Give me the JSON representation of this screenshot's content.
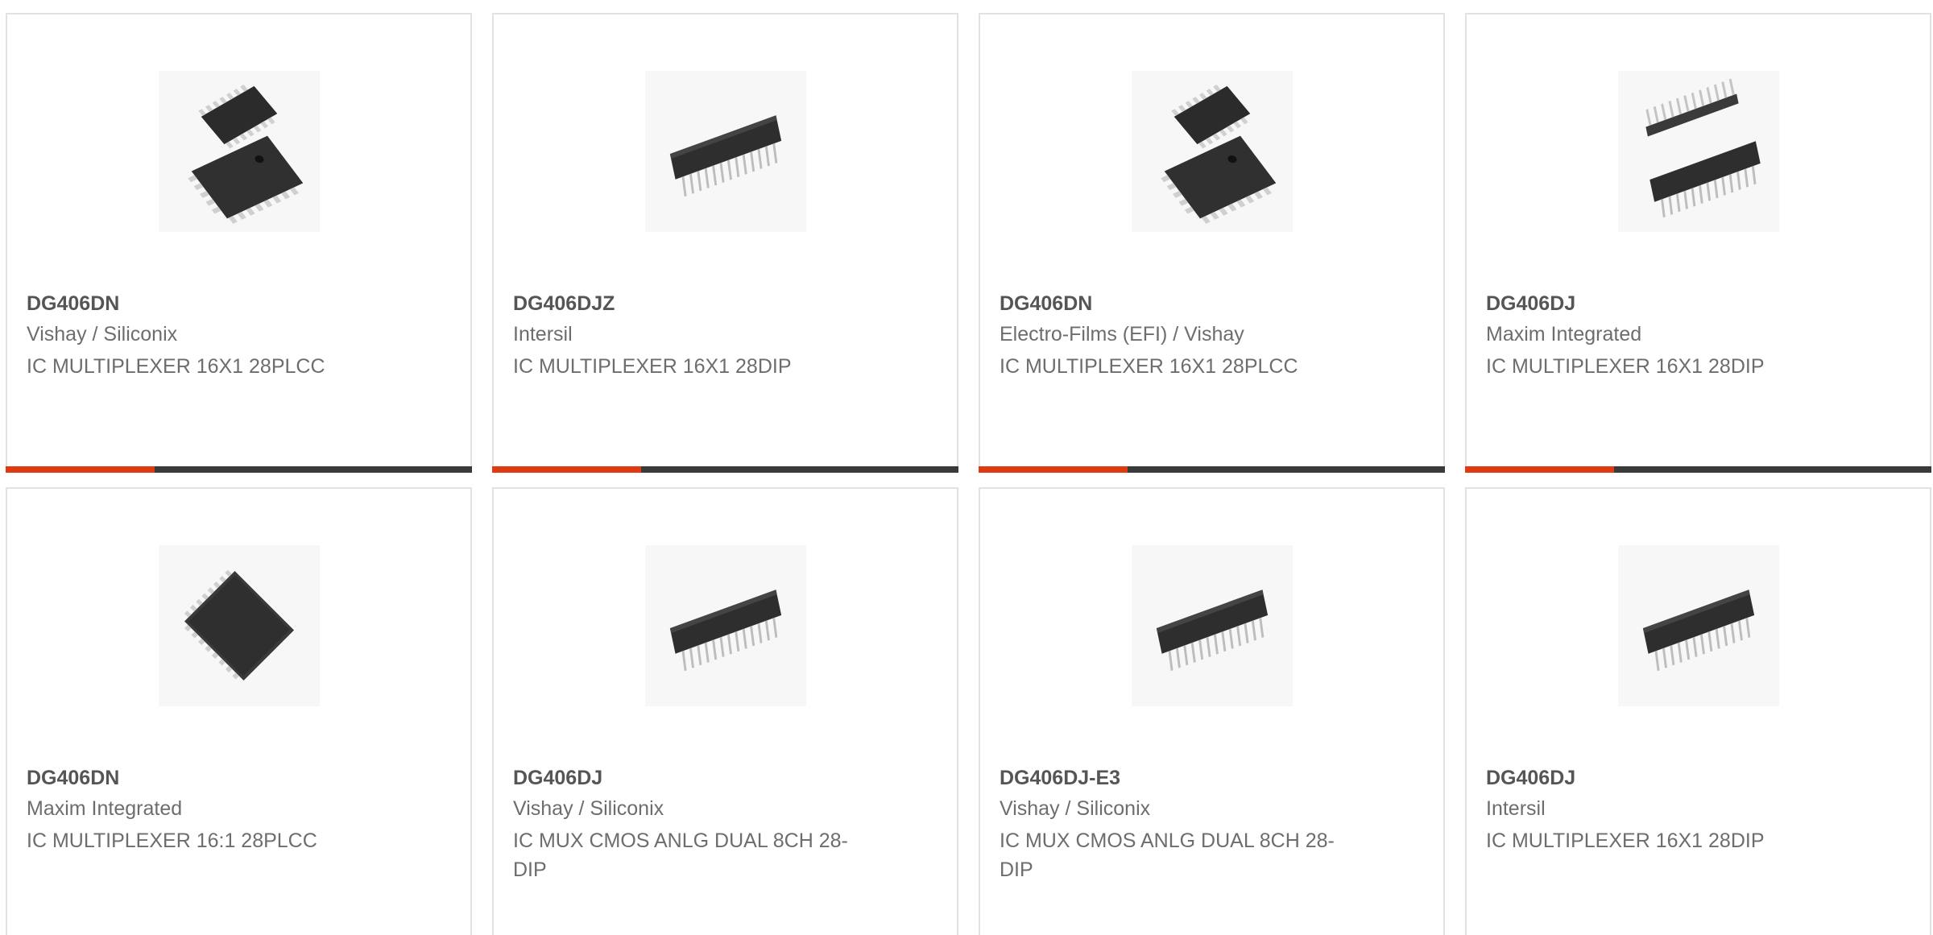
{
  "products": [
    {
      "part": "DG406DN",
      "manufacturer": "Vishay / Siliconix",
      "description": "IC MULTIPLEXER 16X1 28PLCC",
      "image_icon": "plcc-chip-pair-icon"
    },
    {
      "part": "DG406DJZ",
      "manufacturer": "Intersil",
      "description": "IC MULTIPLEXER 16X1 28DIP",
      "image_icon": "dip-chip-icon"
    },
    {
      "part": "DG406DN",
      "manufacturer": "Electro-Films (EFI) / Vishay",
      "description": "IC MULTIPLEXER 16X1 28PLCC",
      "image_icon": "plcc-chip-pair-icon"
    },
    {
      "part": "DG406DJ",
      "manufacturer": "Maxim Integrated",
      "description": "IC MULTIPLEXER 16X1 28DIP",
      "image_icon": "dip-chip-pair-icon"
    },
    {
      "part": "DG406DN",
      "manufacturer": "Maxim Integrated",
      "description": "IC MULTIPLEXER 16:1 28PLCC",
      "image_icon": "plcc-chip-icon"
    },
    {
      "part": "DG406DJ",
      "manufacturer": "Vishay / Siliconix",
      "description": "IC MUX CMOS ANLG DUAL 8CH 28-DIP",
      "image_icon": "dip-chip-icon"
    },
    {
      "part": "DG406DJ-E3",
      "manufacturer": "Vishay / Siliconix",
      "description": "IC MUX CMOS ANLG DUAL 8CH 28-DIP",
      "image_icon": "dip-chip-icon"
    },
    {
      "part": "DG406DJ",
      "manufacturer": "Intersil",
      "description": "IC MULTIPLEXER 16X1 28DIP",
      "image_icon": "dip-chip-icon"
    }
  ],
  "colors": {
    "accent": "#e03a12",
    "bar": "#3a3a3a",
    "border": "#e2e2e2",
    "part_text": "#555555",
    "body_text": "#6d6d6d"
  }
}
